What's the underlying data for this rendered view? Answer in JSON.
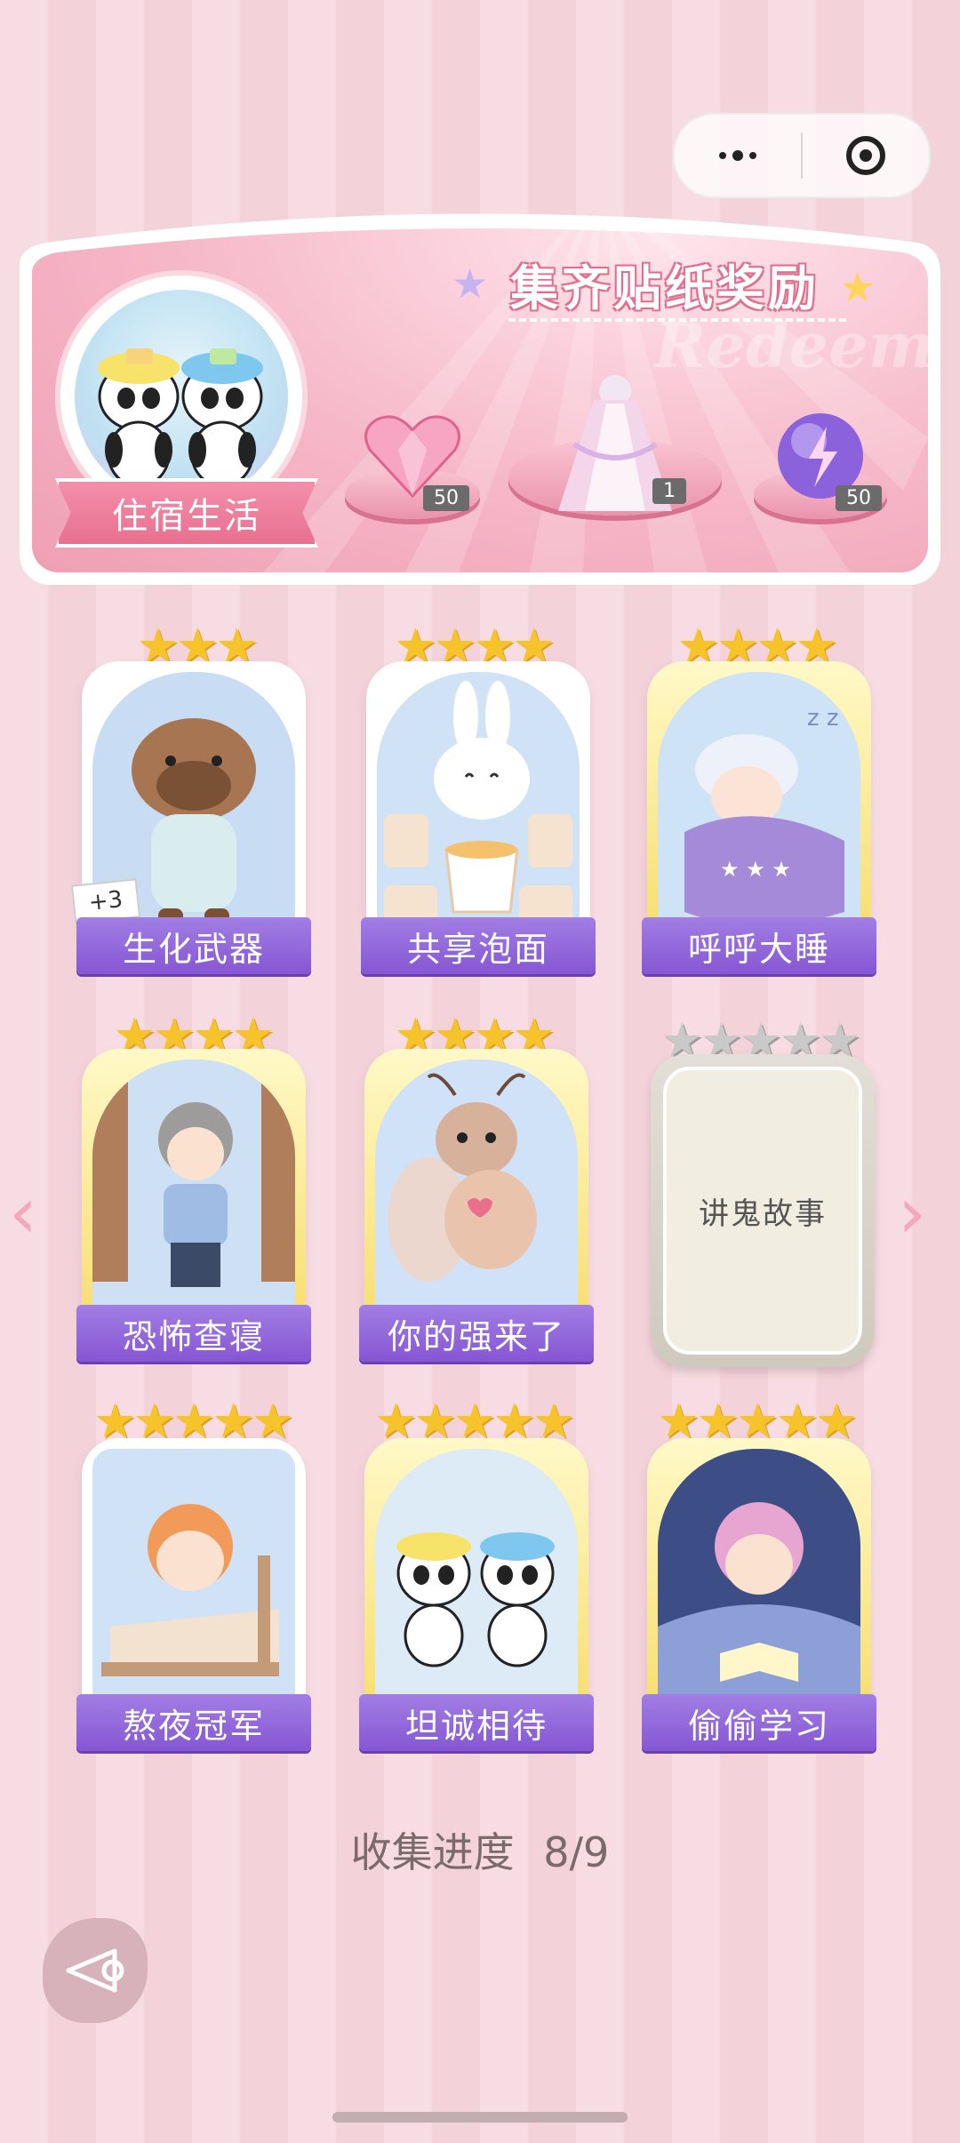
{
  "capsule": {
    "more_icon": "more-dots-icon",
    "close_icon": "target-circle-icon"
  },
  "banner": {
    "title": "集齐贴纸奖励",
    "watermark": "Redeem",
    "category": "住宿生活",
    "rewards": [
      {
        "icon": "pink-heart-gem-icon",
        "count": "50"
      },
      {
        "icon": "dress-outfit-icon",
        "count": "1"
      },
      {
        "icon": "purple-energy-orb-icon",
        "count": "50"
      }
    ]
  },
  "stickers": [
    {
      "name": "生化武器",
      "stars": 3,
      "extra": "+3",
      "collected": true
    },
    {
      "name": "共享泡面",
      "stars": 4,
      "collected": true
    },
    {
      "name": "呼呼大睡",
      "stars": 4,
      "collected": true
    },
    {
      "name": "恐怖查寝",
      "stars": 4,
      "collected": true
    },
    {
      "name": "你的强来了",
      "stars": 4,
      "collected": true
    },
    {
      "name": "讲鬼故事",
      "stars": 5,
      "collected": false
    },
    {
      "name": "熬夜冠军",
      "stars": 5,
      "collected": true
    },
    {
      "name": "坦诚相待",
      "stars": 5,
      "collected": true
    },
    {
      "name": "偷偷学习",
      "stars": 5,
      "collected": true
    }
  ],
  "progress": {
    "label": "收集进度",
    "value": "8/9"
  },
  "colors": {
    "label_purple": "#8656d3",
    "banner_pink": "#ef9fb4",
    "star_gold": "#f6c42a"
  }
}
